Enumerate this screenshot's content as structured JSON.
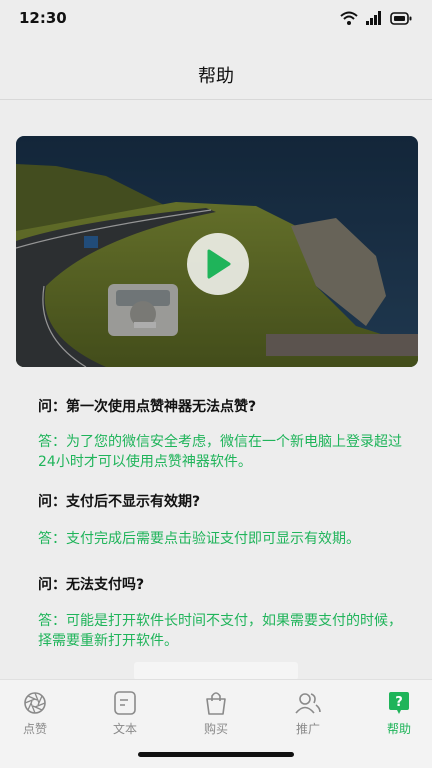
{
  "status": {
    "time": "12:30"
  },
  "nav": {
    "title": "帮助"
  },
  "faq": [
    {
      "q": "问：第一次使用点赞神器无法点赞?",
      "a": "答：为了您的微信安全考虑，微信在一个新电脑上登录超过24小时才可以使用点赞神器软件。"
    },
    {
      "q": "问：支付后不显示有效期?",
      "a": "答：支付完成后需要点击验证支付即可显示有效期。"
    },
    {
      "q": "问：无法支付吗?",
      "a": "答：可能是打开软件长时间不支付，如果需要支付的时候，择需要重新打开软件。"
    }
  ],
  "tabs": [
    {
      "label": "点赞",
      "icon": "shutter-icon"
    },
    {
      "label": "文本",
      "icon": "text-doc-icon"
    },
    {
      "label": "购买",
      "icon": "shopping-bag-icon"
    },
    {
      "label": "推广",
      "icon": "users-icon"
    },
    {
      "label": "帮助",
      "icon": "help-icon"
    }
  ],
  "colors": {
    "accent": "#1fb45a",
    "background": "#ededed"
  }
}
